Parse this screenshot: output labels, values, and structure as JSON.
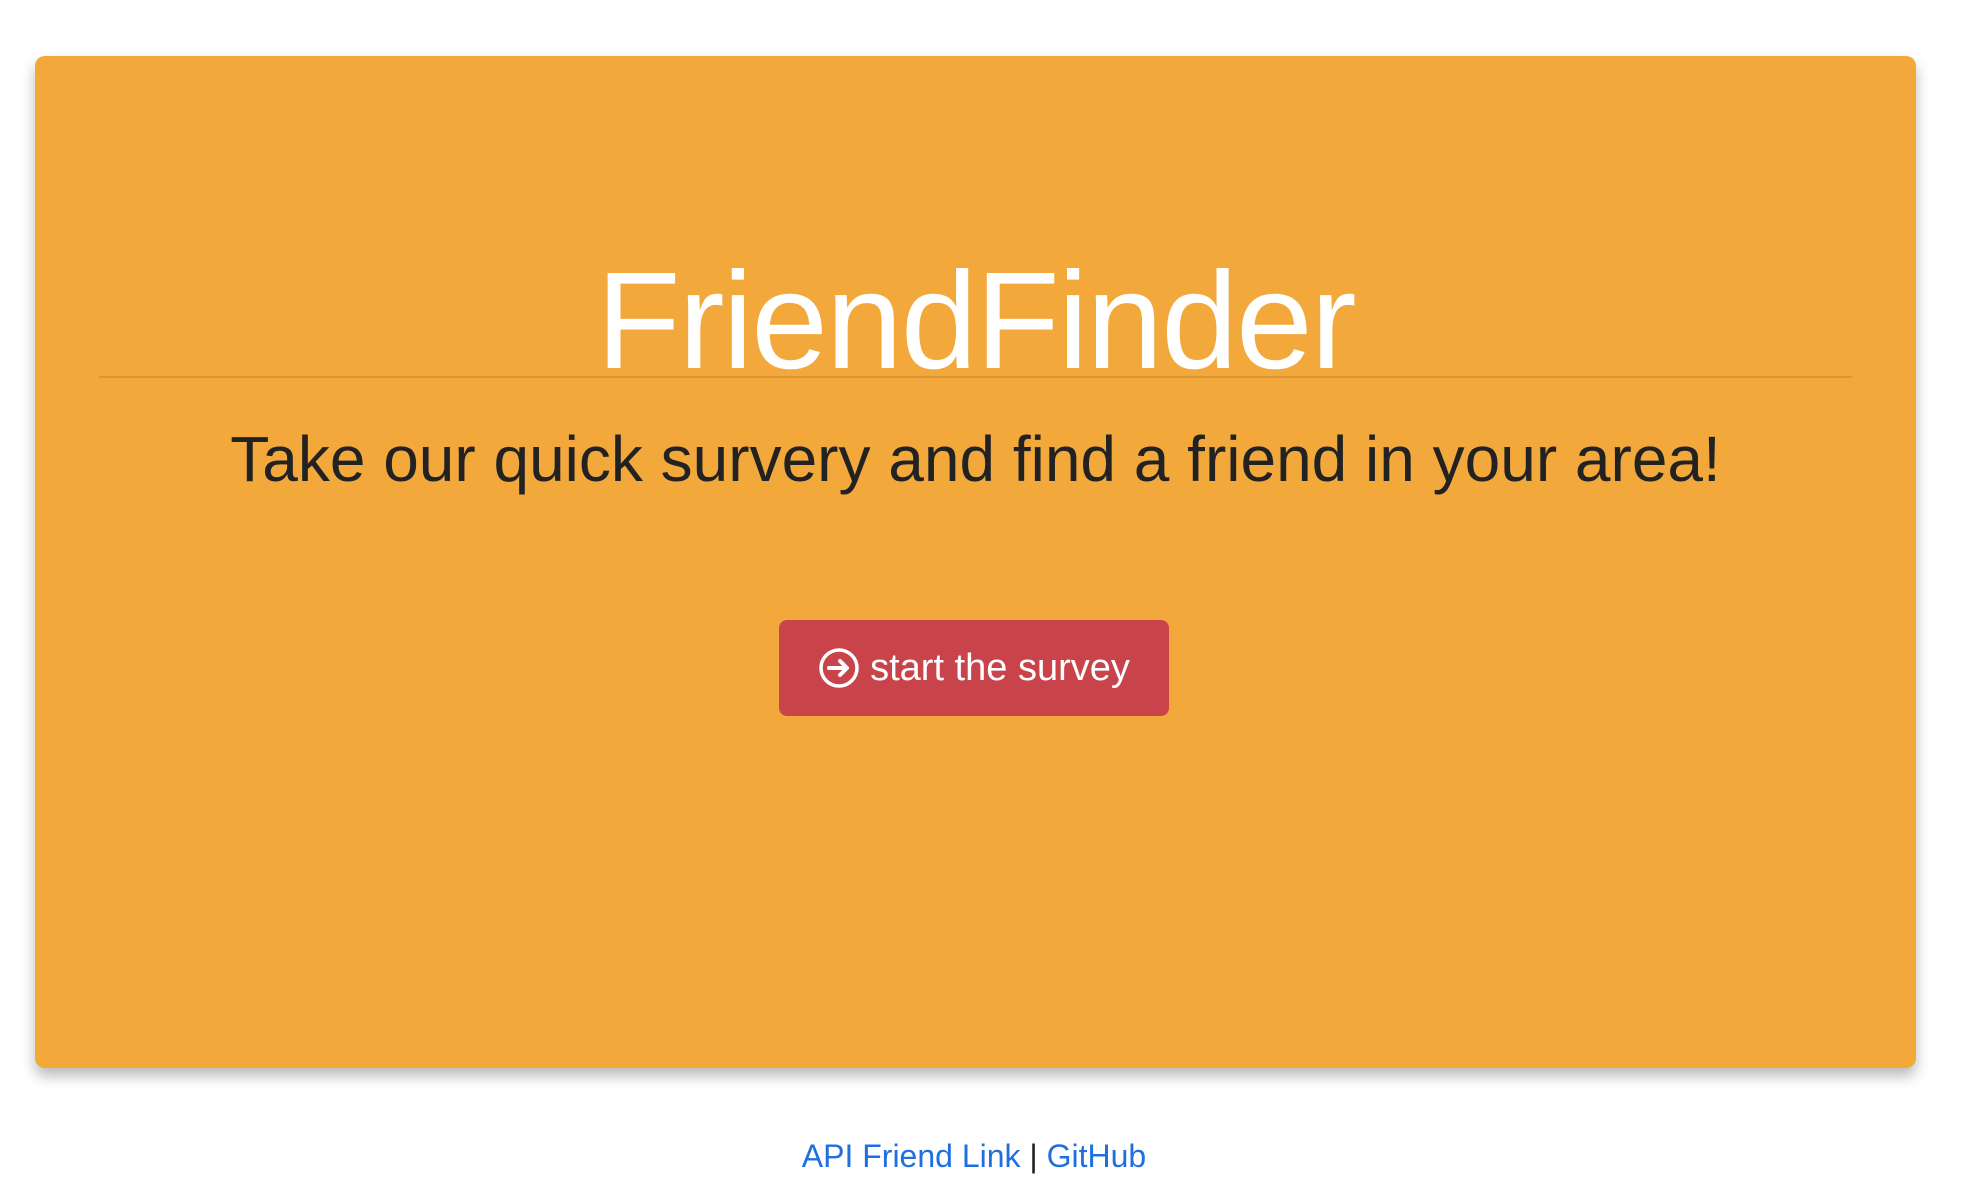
{
  "hero": {
    "title": "FriendFinder",
    "tagline": "Take our quick survery and find a friend in your area!",
    "button_label": "start the survey",
    "button_icon": "arrow-circle-right-icon"
  },
  "footer": {
    "api_link": "API Friend Link",
    "separator": "|",
    "github_link": "GitHub"
  },
  "colors": {
    "jumbotron_bg": "#f2a83b",
    "button_bg": "#c9434b",
    "link": "#1f6fe0"
  }
}
